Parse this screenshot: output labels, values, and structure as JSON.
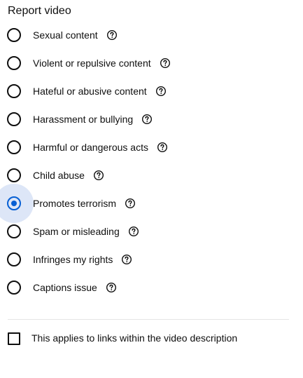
{
  "dialog": {
    "title": "Report video"
  },
  "options": [
    {
      "label": "Sexual content",
      "selected": false,
      "help_icon": "help-circle-icon"
    },
    {
      "label": "Violent or repulsive content",
      "selected": false,
      "help_icon": "help-circle-icon"
    },
    {
      "label": "Hateful or abusive content",
      "selected": false,
      "help_icon": "help-circle-icon"
    },
    {
      "label": "Harassment or bullying",
      "selected": false,
      "help_icon": "help-circle-icon"
    },
    {
      "label": "Harmful or dangerous acts",
      "selected": false,
      "help_icon": "help-circle-icon"
    },
    {
      "label": "Child abuse",
      "selected": false,
      "help_icon": "help-circle-icon"
    },
    {
      "label": "Promotes terrorism",
      "selected": true,
      "help_icon": "help-circle-icon"
    },
    {
      "label": "Spam or misleading",
      "selected": false,
      "help_icon": "help-circle-icon"
    },
    {
      "label": "Infringes my rights",
      "selected": false,
      "help_icon": "help-circle-icon"
    },
    {
      "label": "Captions issue",
      "selected": false,
      "help_icon": "help-circle-icon"
    }
  ],
  "links_checkbox": {
    "label": "This applies to links within the video description",
    "checked": false
  },
  "colors": {
    "accent": "#065fd4",
    "selected_halo": "#dde6f7",
    "text": "#0f0f0f",
    "divider": "#e5e5e5"
  }
}
